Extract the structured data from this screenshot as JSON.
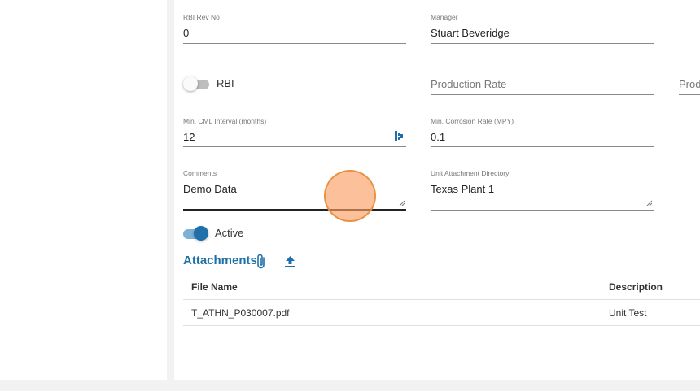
{
  "form": {
    "rbi_rev_no": {
      "label": "RBI Rev No",
      "value": "0"
    },
    "manager": {
      "label": "Manager",
      "value": "Stuart Beveridge"
    },
    "rbi_toggle": {
      "label": "RBI",
      "checked": false
    },
    "production_rate": {
      "placeholder": "Production Rate"
    },
    "production_rate_2": {
      "placeholder": "Prod"
    },
    "min_cml_interval": {
      "label": "Min. CML Interval (months)",
      "value": "12"
    },
    "min_corrosion_rate": {
      "label": "Min. Corrosion Rate (MPY)",
      "value": "0.1"
    },
    "comments": {
      "label": "Comments",
      "value": "Demo Data"
    },
    "unit_attachment_directory": {
      "label": "Unit Attachment Directory",
      "value": "Texas Plant 1"
    },
    "active_toggle": {
      "label": "Active",
      "checked": true
    }
  },
  "attachments": {
    "title": "Attachments",
    "columns": [
      "File Name",
      "Description"
    ],
    "rows": [
      {
        "file_name": "T_ATHN_P030007.pdf",
        "description": "Unit Test"
      }
    ]
  },
  "colors": {
    "accent": "#1f6fa8",
    "cursor": "#fba064"
  },
  "icons": [
    "calculator-icon",
    "resize-handle-icon",
    "paperclip-icon",
    "upload-icon"
  ]
}
